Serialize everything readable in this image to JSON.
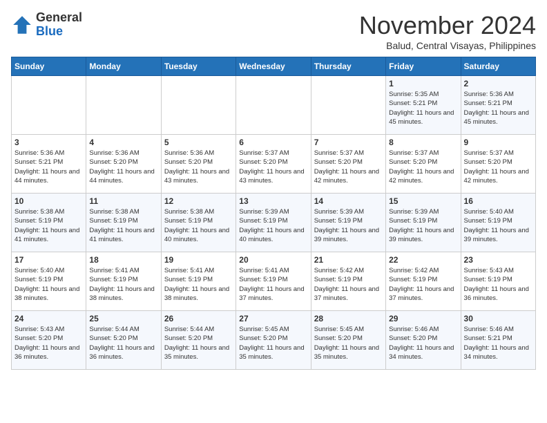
{
  "header": {
    "logo_general": "General",
    "logo_blue": "Blue",
    "month": "November 2024",
    "location": "Balud, Central Visayas, Philippines"
  },
  "weekdays": [
    "Sunday",
    "Monday",
    "Tuesday",
    "Wednesday",
    "Thursday",
    "Friday",
    "Saturday"
  ],
  "weeks": [
    [
      {
        "day": "",
        "sunrise": "",
        "sunset": "",
        "daylight": ""
      },
      {
        "day": "",
        "sunrise": "",
        "sunset": "",
        "daylight": ""
      },
      {
        "day": "",
        "sunrise": "",
        "sunset": "",
        "daylight": ""
      },
      {
        "day": "",
        "sunrise": "",
        "sunset": "",
        "daylight": ""
      },
      {
        "day": "",
        "sunrise": "",
        "sunset": "",
        "daylight": ""
      },
      {
        "day": "1",
        "sunrise": "Sunrise: 5:35 AM",
        "sunset": "Sunset: 5:21 PM",
        "daylight": "Daylight: 11 hours and 45 minutes."
      },
      {
        "day": "2",
        "sunrise": "Sunrise: 5:36 AM",
        "sunset": "Sunset: 5:21 PM",
        "daylight": "Daylight: 11 hours and 45 minutes."
      }
    ],
    [
      {
        "day": "3",
        "sunrise": "Sunrise: 5:36 AM",
        "sunset": "Sunset: 5:21 PM",
        "daylight": "Daylight: 11 hours and 44 minutes."
      },
      {
        "day": "4",
        "sunrise": "Sunrise: 5:36 AM",
        "sunset": "Sunset: 5:20 PM",
        "daylight": "Daylight: 11 hours and 44 minutes."
      },
      {
        "day": "5",
        "sunrise": "Sunrise: 5:36 AM",
        "sunset": "Sunset: 5:20 PM",
        "daylight": "Daylight: 11 hours and 43 minutes."
      },
      {
        "day": "6",
        "sunrise": "Sunrise: 5:37 AM",
        "sunset": "Sunset: 5:20 PM",
        "daylight": "Daylight: 11 hours and 43 minutes."
      },
      {
        "day": "7",
        "sunrise": "Sunrise: 5:37 AM",
        "sunset": "Sunset: 5:20 PM",
        "daylight": "Daylight: 11 hours and 42 minutes."
      },
      {
        "day": "8",
        "sunrise": "Sunrise: 5:37 AM",
        "sunset": "Sunset: 5:20 PM",
        "daylight": "Daylight: 11 hours and 42 minutes."
      },
      {
        "day": "9",
        "sunrise": "Sunrise: 5:37 AM",
        "sunset": "Sunset: 5:20 PM",
        "daylight": "Daylight: 11 hours and 42 minutes."
      }
    ],
    [
      {
        "day": "10",
        "sunrise": "Sunrise: 5:38 AM",
        "sunset": "Sunset: 5:19 PM",
        "daylight": "Daylight: 11 hours and 41 minutes."
      },
      {
        "day": "11",
        "sunrise": "Sunrise: 5:38 AM",
        "sunset": "Sunset: 5:19 PM",
        "daylight": "Daylight: 11 hours and 41 minutes."
      },
      {
        "day": "12",
        "sunrise": "Sunrise: 5:38 AM",
        "sunset": "Sunset: 5:19 PM",
        "daylight": "Daylight: 11 hours and 40 minutes."
      },
      {
        "day": "13",
        "sunrise": "Sunrise: 5:39 AM",
        "sunset": "Sunset: 5:19 PM",
        "daylight": "Daylight: 11 hours and 40 minutes."
      },
      {
        "day": "14",
        "sunrise": "Sunrise: 5:39 AM",
        "sunset": "Sunset: 5:19 PM",
        "daylight": "Daylight: 11 hours and 39 minutes."
      },
      {
        "day": "15",
        "sunrise": "Sunrise: 5:39 AM",
        "sunset": "Sunset: 5:19 PM",
        "daylight": "Daylight: 11 hours and 39 minutes."
      },
      {
        "day": "16",
        "sunrise": "Sunrise: 5:40 AM",
        "sunset": "Sunset: 5:19 PM",
        "daylight": "Daylight: 11 hours and 39 minutes."
      }
    ],
    [
      {
        "day": "17",
        "sunrise": "Sunrise: 5:40 AM",
        "sunset": "Sunset: 5:19 PM",
        "daylight": "Daylight: 11 hours and 38 minutes."
      },
      {
        "day": "18",
        "sunrise": "Sunrise: 5:41 AM",
        "sunset": "Sunset: 5:19 PM",
        "daylight": "Daylight: 11 hours and 38 minutes."
      },
      {
        "day": "19",
        "sunrise": "Sunrise: 5:41 AM",
        "sunset": "Sunset: 5:19 PM",
        "daylight": "Daylight: 11 hours and 38 minutes."
      },
      {
        "day": "20",
        "sunrise": "Sunrise: 5:41 AM",
        "sunset": "Sunset: 5:19 PM",
        "daylight": "Daylight: 11 hours and 37 minutes."
      },
      {
        "day": "21",
        "sunrise": "Sunrise: 5:42 AM",
        "sunset": "Sunset: 5:19 PM",
        "daylight": "Daylight: 11 hours and 37 minutes."
      },
      {
        "day": "22",
        "sunrise": "Sunrise: 5:42 AM",
        "sunset": "Sunset: 5:19 PM",
        "daylight": "Daylight: 11 hours and 37 minutes."
      },
      {
        "day": "23",
        "sunrise": "Sunrise: 5:43 AM",
        "sunset": "Sunset: 5:19 PM",
        "daylight": "Daylight: 11 hours and 36 minutes."
      }
    ],
    [
      {
        "day": "24",
        "sunrise": "Sunrise: 5:43 AM",
        "sunset": "Sunset: 5:20 PM",
        "daylight": "Daylight: 11 hours and 36 minutes."
      },
      {
        "day": "25",
        "sunrise": "Sunrise: 5:44 AM",
        "sunset": "Sunset: 5:20 PM",
        "daylight": "Daylight: 11 hours and 36 minutes."
      },
      {
        "day": "26",
        "sunrise": "Sunrise: 5:44 AM",
        "sunset": "Sunset: 5:20 PM",
        "daylight": "Daylight: 11 hours and 35 minutes."
      },
      {
        "day": "27",
        "sunrise": "Sunrise: 5:45 AM",
        "sunset": "Sunset: 5:20 PM",
        "daylight": "Daylight: 11 hours and 35 minutes."
      },
      {
        "day": "28",
        "sunrise": "Sunrise: 5:45 AM",
        "sunset": "Sunset: 5:20 PM",
        "daylight": "Daylight: 11 hours and 35 minutes."
      },
      {
        "day": "29",
        "sunrise": "Sunrise: 5:46 AM",
        "sunset": "Sunset: 5:20 PM",
        "daylight": "Daylight: 11 hours and 34 minutes."
      },
      {
        "day": "30",
        "sunrise": "Sunrise: 5:46 AM",
        "sunset": "Sunset: 5:21 PM",
        "daylight": "Daylight: 11 hours and 34 minutes."
      }
    ]
  ]
}
